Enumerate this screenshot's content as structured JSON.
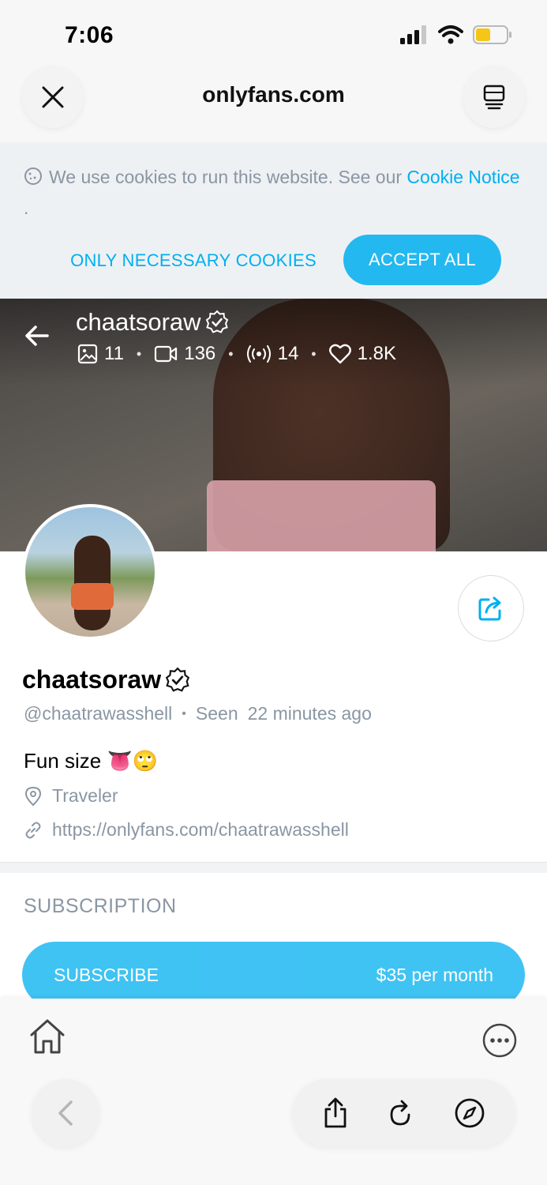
{
  "status_bar": {
    "time": "7:06",
    "signal_icon": "cellular-signal-icon",
    "wifi_icon": "wifi-icon",
    "battery_icon": "battery-icon",
    "battery_color": "#f5c518"
  },
  "browser": {
    "url": "onlyfans.com",
    "close_icon": "close-icon",
    "tabs_icon": "tabs-icon"
  },
  "cookie_banner": {
    "text": "We use cookies to run this website. See our ",
    "link": "Cookie Notice",
    "suffix": " .",
    "necessary_label": "ONLY NECESSARY COOKIES",
    "accept_label": "ACCEPT ALL"
  },
  "cover": {
    "name": "chaatsoraw",
    "stats": {
      "photos": "11",
      "videos": "136",
      "streams": "14",
      "likes": "1.8K"
    }
  },
  "profile": {
    "name": "chaatsoraw",
    "handle": "@chaatrawasshell",
    "seen_label": "Seen",
    "seen_time": "22 minutes ago",
    "bio": "Fun size 👅🙄",
    "location": "Traveler",
    "link": "https://onlyfans.com/chaatrawasshell"
  },
  "subscription": {
    "heading": "SUBSCRIPTION",
    "button_label": "SUBSCRIBE",
    "price": "$35 per month"
  },
  "colors": {
    "accent": "#00aff0",
    "muted_text": "#8a96a3"
  }
}
